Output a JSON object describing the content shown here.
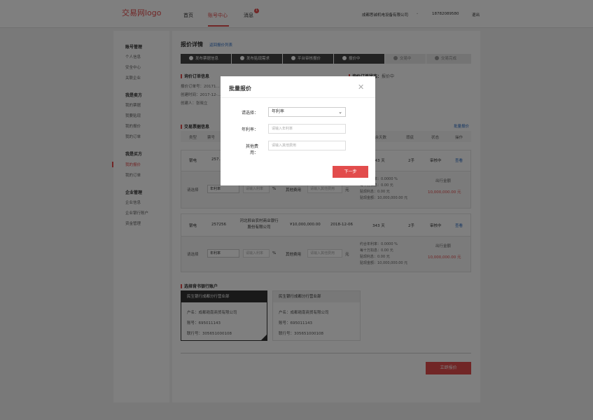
{
  "header": {
    "logo": "交易网logo",
    "nav": [
      "首页",
      "账号中心",
      "消息"
    ],
    "msg_badge": "1",
    "company": "成都思诚机电设备有限公司",
    "company_chevron": "chevron-down-icon",
    "phone": "18782089580",
    "logout": "退出"
  },
  "sidebar": {
    "groups": [
      {
        "title": "账号管理",
        "items": [
          "个人信息",
          "安全中心",
          "关联企业"
        ]
      },
      {
        "title": "我是卖方",
        "items": [
          "我的票据",
          "我要贴现",
          "我的报价",
          "我的订单"
        ]
      },
      {
        "title": "我是买方",
        "items": [
          "我的报价",
          "我的订单"
        ]
      },
      {
        "title": "企业管理",
        "items": [
          "企业信息",
          "企业银行账户",
          "资金管理"
        ]
      }
    ]
  },
  "page": {
    "title": "报价详情",
    "back_link": "返回报价列表"
  },
  "steps": [
    "发布票据信息",
    "发布贴现需求",
    "平台审核报价",
    "报价中",
    "交易中",
    "交易完成"
  ],
  "order_info": {
    "heading": "询价订单信息",
    "lines": [
      "报价订单号：20171...",
      "创建时间：2017-12-...",
      "创建人：张晓立"
    ],
    "status_heading": "询价订单状态：",
    "status": "报价中"
  },
  "bills": {
    "heading": "交易票据信息",
    "batch_link": "批量报价",
    "columns": [
      "类型",
      "票号",
      "承兑人",
      "票面金额",
      "到期日",
      "剩余天数",
      "瑕疵",
      "状态",
      "操作"
    ],
    "rows": [
      {
        "type": "银电",
        "no": "257...",
        "acceptor": "",
        "amount": "",
        "due": "",
        "days": "343 天",
        "flaw": "2手",
        "status": "审核中",
        "op": "查看"
      },
      {
        "type": "银电",
        "no": "257256",
        "acceptor": "河北邢台农村商业银行股份有限公司",
        "amount": "¥10,000,000.00",
        "due": "2018-12-06",
        "days": "343 天",
        "flaw": "2手",
        "status": "审核中",
        "op": "查看"
      }
    ],
    "quote_labels": {
      "select_label": "请选择",
      "select_value": "年利率",
      "rate_placeholder": "请输入利率",
      "percent": "%",
      "fee_label": "其他费用",
      "fee_placeholder": "请输入其他费用",
      "yuan": "元"
    },
    "calc": [
      "约合年利率：0.0000 %",
      "每十万扣息：0.00 元",
      "贴现利息：0.00 元",
      "贴现金额：10,000,000.00 元"
    ],
    "calc_short": [
      "约合年利率：0.0000 %",
      "每十万扣息：0.00 元",
      "贴现利息：0.00 元",
      "贴现金额：10,000,000.00 元"
    ],
    "payout_label": "出行金额",
    "payout_value": "10,000,000.00 元"
  },
  "accounts": {
    "heading": "选择背书银行账户",
    "items": [
      {
        "bank": "民生银行成都分行营业部",
        "name": "户名：成都赣南商贸有限公司",
        "no": "账号：695011143",
        "bank_no": "联行号：305651000108"
      },
      {
        "bank": "民生银行成都分行营业部",
        "name": "户名：成都赣南商贸有限公司",
        "no": "账号：695011143",
        "bank_no": "联行号：305651000108"
      }
    ],
    "submit": "立即报价"
  },
  "modal": {
    "title": "批量报价",
    "close_icon": "close-icon",
    "select_label": "请选择：",
    "select_value": "年利率",
    "rate_label": "年利率：",
    "rate_placeholder": "请输入年利率",
    "fee_label": "其他费用：",
    "fee_placeholder": "请输入其他费用",
    "next": "下一步"
  },
  "colors": {
    "accent": "#e24c4c",
    "link": "#2b6cc4"
  }
}
